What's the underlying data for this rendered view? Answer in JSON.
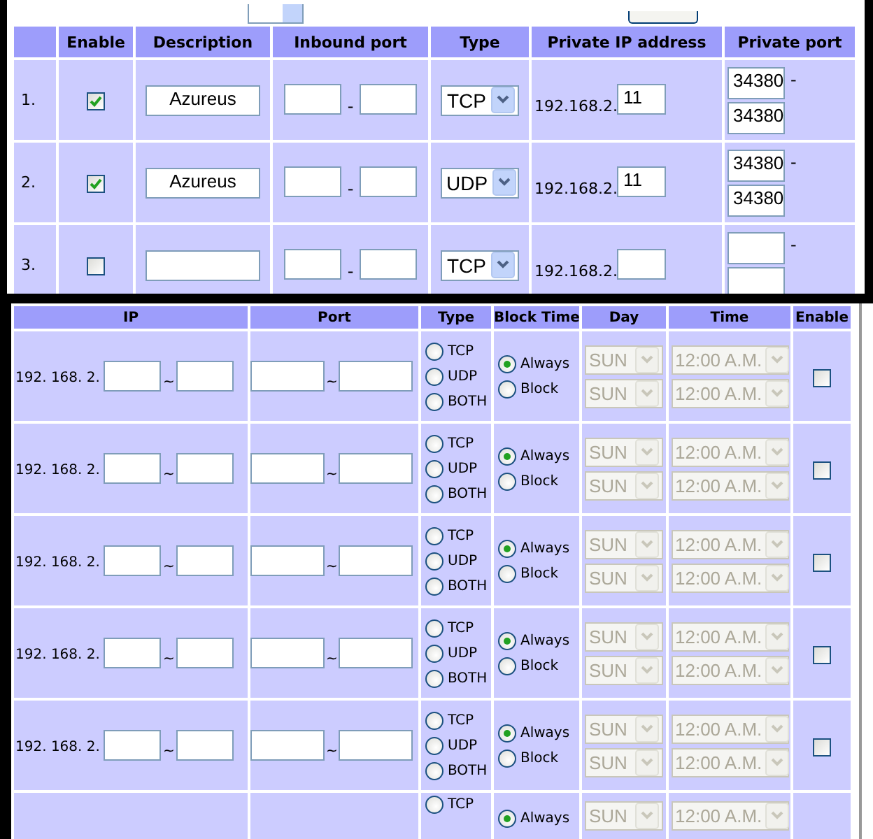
{
  "port_forwarding": {
    "columns": [
      "",
      "Enable",
      "Description",
      "Inbound port",
      "Type",
      "Private IP address",
      "Private port"
    ],
    "rows": [
      {
        "number": "1.",
        "enabled": true,
        "description": "Azureus",
        "inbound_separator": "-",
        "type": "TCP",
        "ip_prefix": "192.168.2.",
        "ip_suffix": "11",
        "private_from": "34380",
        "private_separator": "-",
        "private_to": "34380"
      },
      {
        "number": "2.",
        "enabled": true,
        "description": "Azureus",
        "inbound_separator": "-",
        "type": "UDP",
        "ip_prefix": "192.168.2.",
        "ip_suffix": "11",
        "private_from": "34380",
        "private_separator": "-",
        "private_to": "34380"
      },
      {
        "number": "3.",
        "enabled": false,
        "description": "",
        "inbound_separator": "-",
        "type": "TCP",
        "ip_prefix": "192.168.2.",
        "ip_suffix": "",
        "private_from": "",
        "private_separator": "-",
        "private_to": ""
      }
    ]
  },
  "ip_filter": {
    "columns": [
      "IP",
      "Port",
      "Type",
      "Block Time",
      "Day",
      "Time",
      "Enable"
    ],
    "rows": [
      {
        "ip_prefix": "192. 168. 2.",
        "ip_separator": "~",
        "port_separator": "~",
        "type_options": [
          {
            "label": "TCP",
            "selected": false
          },
          {
            "label": "UDP",
            "selected": false
          },
          {
            "label": "BOTH",
            "selected": false
          }
        ],
        "block_options": [
          {
            "label": "Always",
            "selected": true
          },
          {
            "label": "Block",
            "selected": false
          }
        ],
        "days": [
          "SUN",
          "SUN"
        ],
        "times": [
          "12:00 A.M.",
          "12:00 A.M."
        ],
        "enabled": false
      },
      {
        "ip_prefix": "192. 168. 2.",
        "ip_separator": "~",
        "port_separator": "~",
        "type_options": [
          {
            "label": "TCP",
            "selected": false
          },
          {
            "label": "UDP",
            "selected": false
          },
          {
            "label": "BOTH",
            "selected": false
          }
        ],
        "block_options": [
          {
            "label": "Always",
            "selected": true
          },
          {
            "label": "Block",
            "selected": false
          }
        ],
        "days": [
          "SUN",
          "SUN"
        ],
        "times": [
          "12:00 A.M.",
          "12:00 A.M."
        ],
        "enabled": false
      },
      {
        "ip_prefix": "192. 168. 2.",
        "ip_separator": "~",
        "port_separator": "~",
        "type_options": [
          {
            "label": "TCP",
            "selected": false
          },
          {
            "label": "UDP",
            "selected": false
          },
          {
            "label": "BOTH",
            "selected": false
          }
        ],
        "block_options": [
          {
            "label": "Always",
            "selected": true
          },
          {
            "label": "Block",
            "selected": false
          }
        ],
        "days": [
          "SUN",
          "SUN"
        ],
        "times": [
          "12:00 A.M.",
          "12:00 A.M."
        ],
        "enabled": false
      },
      {
        "ip_prefix": "192. 168. 2.",
        "ip_separator": "~",
        "port_separator": "~",
        "type_options": [
          {
            "label": "TCP",
            "selected": false
          },
          {
            "label": "UDP",
            "selected": false
          },
          {
            "label": "BOTH",
            "selected": false
          }
        ],
        "block_options": [
          {
            "label": "Always",
            "selected": true
          },
          {
            "label": "Block",
            "selected": false
          }
        ],
        "days": [
          "SUN",
          "SUN"
        ],
        "times": [
          "12:00 A.M.",
          "12:00 A.M."
        ],
        "enabled": false
      },
      {
        "ip_prefix": "192. 168. 2.",
        "ip_separator": "~",
        "port_separator": "~",
        "type_options": [
          {
            "label": "TCP",
            "selected": false
          },
          {
            "label": "UDP",
            "selected": false
          },
          {
            "label": "BOTH",
            "selected": false
          }
        ],
        "block_options": [
          {
            "label": "Always",
            "selected": true
          },
          {
            "label": "Block",
            "selected": false
          }
        ],
        "days": [
          "SUN",
          "SUN"
        ],
        "times": [
          "12:00 A.M.",
          "12:00 A.M."
        ],
        "enabled": false
      },
      {
        "type_options": [
          {
            "label": "TCP",
            "selected": false
          }
        ],
        "block_options": [
          {
            "label": "Always",
            "selected": true
          }
        ],
        "days": [
          "SUN"
        ],
        "times": [
          "12:00 A.M."
        ]
      }
    ]
  }
}
